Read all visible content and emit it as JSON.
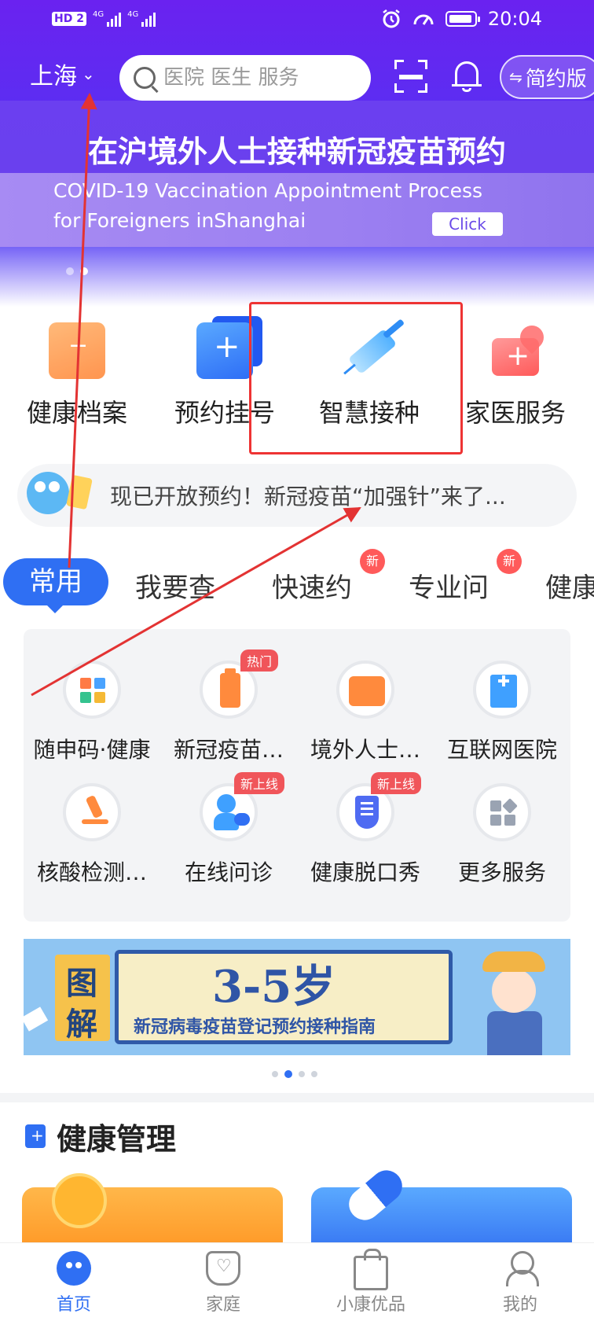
{
  "status_bar": {
    "hd_label": "HD",
    "hd_num": "2",
    "sim1_label": "4G",
    "sim2_label": "4G",
    "time": "20:04"
  },
  "header": {
    "city": "上海",
    "search_placeholder": "医院 医生 服务",
    "simple_version_label": "简约版",
    "switch_icon": "⇋"
  },
  "banner": {
    "title": "在沪境外人士接种新冠疫苗预约",
    "subtitle_line1": "COVID-19 Vaccination Appointment Process",
    "subtitle_line2": "for Foreigners inShanghai",
    "click_label": "Click",
    "page_count": 2,
    "active_page": 2
  },
  "quick_entries": [
    {
      "label": "健康档案",
      "icon": "health-record-folder-icon"
    },
    {
      "label": "预约挂号",
      "icon": "appointment-plus-icon"
    },
    {
      "label": "智慧接种",
      "icon": "vaccine-syringe-icon"
    },
    {
      "label": "家医服务",
      "icon": "family-doctor-kit-icon"
    }
  ],
  "notice": {
    "text": "现已开放预约！新冠疫苗“加强针”来了..."
  },
  "tabs": [
    {
      "label": "常用",
      "active": true,
      "new": false
    },
    {
      "label": "我要查",
      "active": false,
      "new": false
    },
    {
      "label": "快速约",
      "active": false,
      "new": true
    },
    {
      "label": "专业问",
      "active": false,
      "new": true
    },
    {
      "label": "健康",
      "active": false,
      "new": false
    }
  ],
  "new_badge_label": "新",
  "services": [
    {
      "label": "随申码·健康",
      "tag": "",
      "icon": "qr-code-icon"
    },
    {
      "label": "新冠疫苗…",
      "tag": "热门",
      "icon": "vaccine-bottle-icon"
    },
    {
      "label": "境外人士…",
      "tag": "",
      "icon": "covid19-certificate-icon"
    },
    {
      "label": "互联网医院",
      "tag": "",
      "icon": "hospital-building-icon"
    },
    {
      "label": "核酸检测…",
      "tag": "",
      "icon": "microscope-icon"
    },
    {
      "label": "在线问诊",
      "tag": "新上线",
      "icon": "doctor-chat-icon"
    },
    {
      "label": "健康脱口秀",
      "tag": "新上线",
      "icon": "microphone-icon"
    },
    {
      "label": "更多服务",
      "tag": "",
      "icon": "more-grid-icon"
    }
  ],
  "promo": {
    "tu": "图",
    "jie": "解",
    "age": "3-5岁",
    "subtitle": "新冠病毒疫苗登记预约接种指南",
    "page_count": 4,
    "active_page": 2
  },
  "health_management": {
    "title": "健康管理"
  },
  "bottom_nav": [
    {
      "label": "首页",
      "active": true,
      "icon": "home-mascot-icon"
    },
    {
      "label": "家庭",
      "active": false,
      "icon": "family-shield-icon"
    },
    {
      "label": "小康优品",
      "active": false,
      "icon": "shopping-bag-icon"
    },
    {
      "label": "我的",
      "active": false,
      "icon": "profile-icon"
    }
  ],
  "colors": {
    "brand_purple": "#6a22f0",
    "brand_blue": "#2f6ff3",
    "annotation_red": "#e33333",
    "tag_red": "#f0555a"
  }
}
